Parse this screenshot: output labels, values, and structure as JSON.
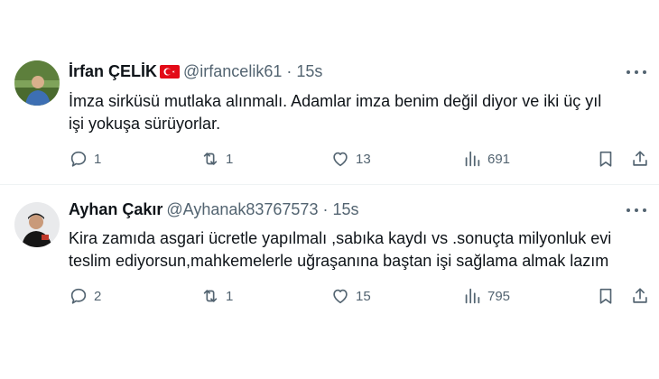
{
  "tweets": [
    {
      "name": "İrfan ÇELİK",
      "has_flag": true,
      "handle": "@irfancelik61",
      "separator": "·",
      "time": "15s",
      "lines": [
        "İmza sirküsü mutlaka alınmalı. Adamlar imza benim değil diyor ve iki üç yıl",
        "işi yokuşa sürüyorlar."
      ],
      "replies": "1",
      "retweets": "1",
      "likes": "13",
      "views": "691"
    },
    {
      "name": "Ayhan Çakır",
      "has_flag": false,
      "handle": "@Ayhanak83767573",
      "separator": "·",
      "time": "15s",
      "lines": [
        "Kira zamıda asgari ücretle yapılmalı ,sabıka kaydı vs .sonuçta milyonluk evi",
        "teslim ediyorsun,mahkemelerle uğraşanına baştan işi sağlama almak lazım"
      ],
      "replies": "2",
      "retweets": "1",
      "likes": "15",
      "views": "795"
    }
  ],
  "colors": {
    "text_primary": "#0f1419",
    "text_secondary": "#536471",
    "divider": "#eff3f4",
    "flag_red": "#e30a17"
  },
  "icons": [
    "reply-icon",
    "retweet-icon",
    "like-icon",
    "views-icon",
    "bookmark-icon",
    "share-icon",
    "more-icon",
    "turkey-flag-icon"
  ]
}
